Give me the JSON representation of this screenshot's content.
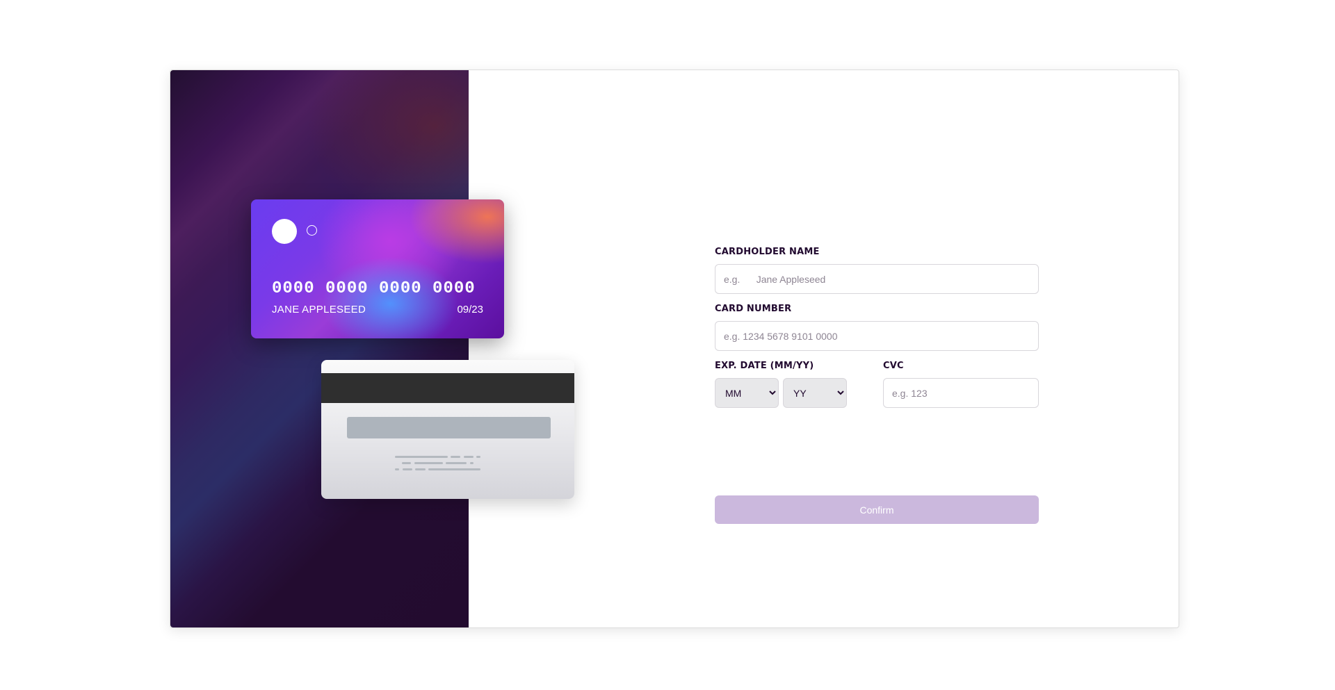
{
  "card_front": {
    "number": "0000 0000 0000 0000",
    "name": "JANE APPLESEED",
    "exp": "09/23"
  },
  "form": {
    "cardholder_label": "CARDHOLDER NAME",
    "cardholder_placeholder": "e.g.      Jane Appleseed",
    "number_label": "CARD NUMBER",
    "number_placeholder": "e.g. 1234 5678 9101 0000",
    "exp_label": "EXP. DATE (MM/YY)",
    "month_value": "MM",
    "year_value": "YY",
    "cvc_label": "CVC",
    "cvc_placeholder": "e.g. 123",
    "confirm_label": "Confirm"
  },
  "colors": {
    "accent": "#21092f",
    "button_disabled": "#cbb8dd",
    "card_gradient_start": "#6a3cf0",
    "card_gradient_end": "#5b0f9e"
  }
}
